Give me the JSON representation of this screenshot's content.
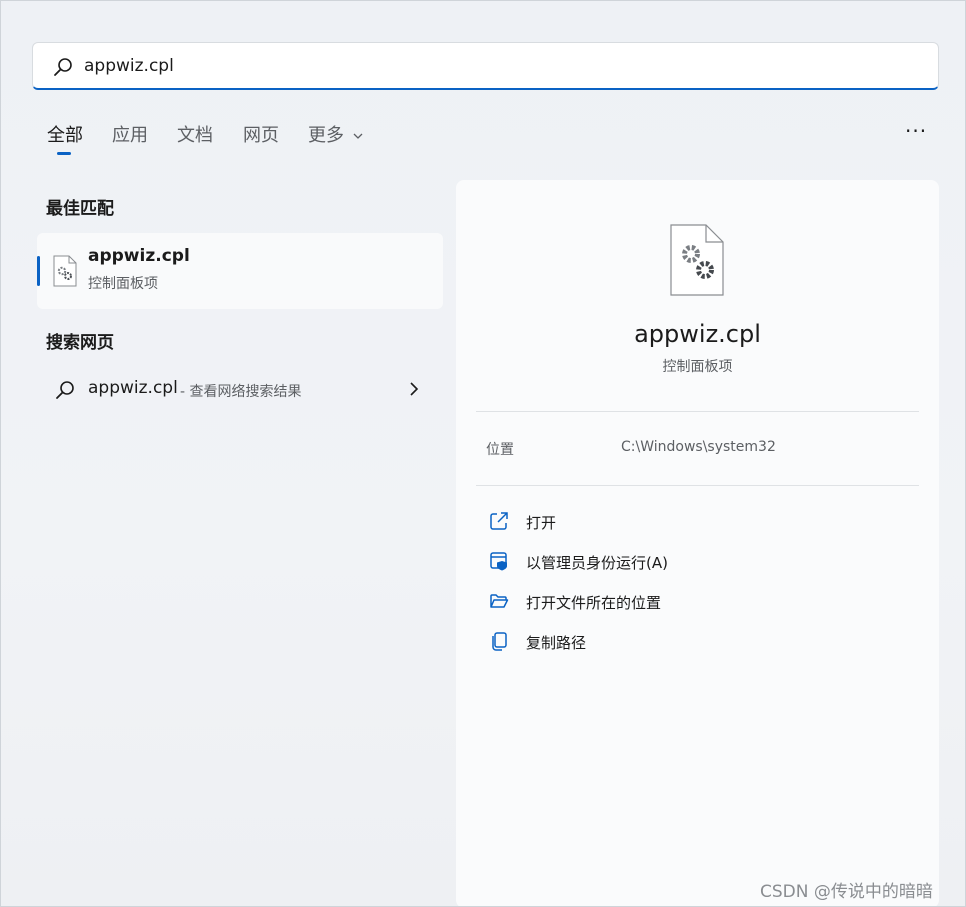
{
  "search": {
    "value": "appwiz.cpl"
  },
  "tabs": [
    {
      "label": "全部"
    },
    {
      "label": "应用"
    },
    {
      "label": "文档"
    },
    {
      "label": "网页"
    },
    {
      "label": "更多"
    }
  ],
  "more_options": "···",
  "best_match": {
    "section_title": "最佳匹配",
    "title": "appwiz.cpl",
    "subtitle": "控制面板项"
  },
  "web_search": {
    "section_title": "搜索网页",
    "title": "appwiz.cpl",
    "subtitle": "- 查看网络搜索结果"
  },
  "detail": {
    "name": "appwiz.cpl",
    "type": "控制面板项",
    "location_label": "位置",
    "location_value": "C:\\Windows\\system32",
    "actions": [
      {
        "label": "打开",
        "icon": "open-external-icon"
      },
      {
        "label": "以管理员身份运行(A)",
        "icon": "run-as-admin-icon"
      },
      {
        "label": "打开文件所在的位置",
        "icon": "folder-open-icon"
      },
      {
        "label": "复制路径",
        "icon": "copy-icon"
      }
    ]
  },
  "watermark": "CSDN @传说中的暗暗",
  "colors": {
    "accent": "#0a62c4",
    "panel": "#fafbfc",
    "background": "#eef1f5"
  }
}
